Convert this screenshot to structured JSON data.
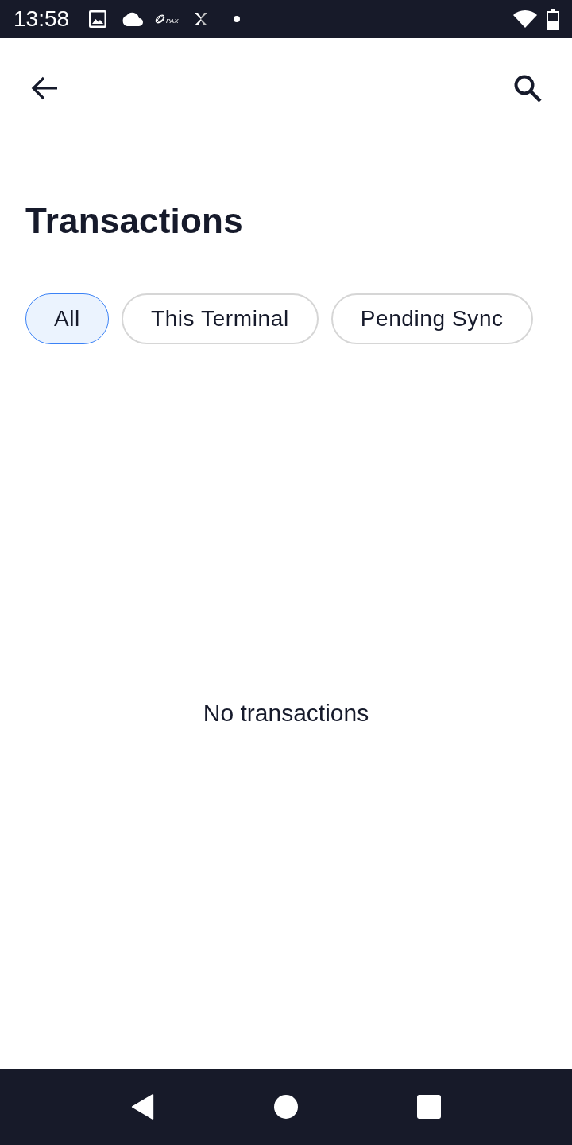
{
  "status_bar": {
    "time": "13:58",
    "logo_text": "PAX"
  },
  "title": "Transactions",
  "filters": [
    {
      "label": "All",
      "selected": true
    },
    {
      "label": "This Terminal",
      "selected": false
    },
    {
      "label": "Pending Sync",
      "selected": false
    }
  ],
  "empty_state": "No transactions"
}
